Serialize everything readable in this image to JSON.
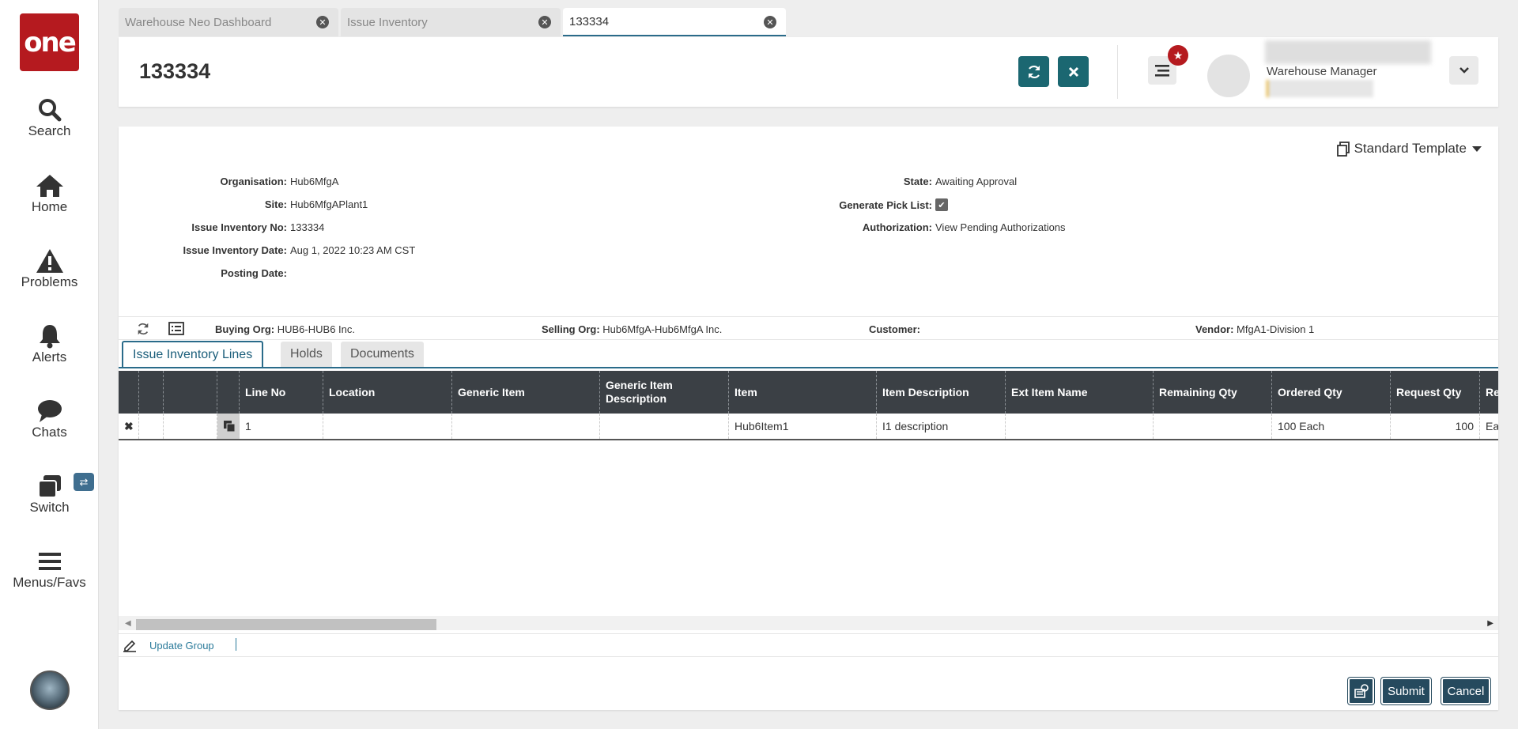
{
  "sidebar": {
    "logo": "one",
    "items": [
      {
        "label": "Search",
        "icon": "search-icon"
      },
      {
        "label": "Home",
        "icon": "home-icon"
      },
      {
        "label": "Problems",
        "icon": "warning-icon"
      },
      {
        "label": "Alerts",
        "icon": "bell-icon"
      },
      {
        "label": "Chats",
        "icon": "chat-icon"
      },
      {
        "label": "Switch",
        "icon": "switch-icon"
      },
      {
        "label": "Menus/Favs",
        "icon": "menu-icon"
      }
    ]
  },
  "tabs": [
    {
      "label": "Warehouse Neo Dashboard"
    },
    {
      "label": "Issue Inventory"
    },
    {
      "label": "133334"
    }
  ],
  "header": {
    "title": "133334",
    "user_role": "Warehouse Manager"
  },
  "template": {
    "label": "Standard Template"
  },
  "details": {
    "left": [
      {
        "label": "Organisation:",
        "value": "Hub6MfgA"
      },
      {
        "label": "Site:",
        "value": "Hub6MfgAPlant1"
      },
      {
        "label": "Issue Inventory No:",
        "value": "133334"
      },
      {
        "label": "Issue Inventory Date:",
        "value": "Aug 1, 2022 10:23 AM CST"
      },
      {
        "label": "Posting Date:",
        "value": ""
      }
    ],
    "right": [
      {
        "label": "State:",
        "value": "Awaiting Approval"
      },
      {
        "label": "Generate Pick List:",
        "value": "checked"
      },
      {
        "label": "Authorization:",
        "value": "View Pending Authorizations"
      }
    ]
  },
  "org_bar": {
    "buying_org_label": "Buying Org:",
    "buying_org": "HUB6-HUB6 Inc.",
    "selling_org_label": "Selling Org:",
    "selling_org": "Hub6MfgA-Hub6MfgA Inc.",
    "customer_label": "Customer:",
    "customer": "",
    "vendor_label": "Vendor:",
    "vendor": "MfgA1-Division 1"
  },
  "subtabs": [
    {
      "label": "Issue Inventory Lines"
    },
    {
      "label": "Holds"
    },
    {
      "label": "Documents"
    }
  ],
  "grid": {
    "columns": [
      "Line No",
      "Location",
      "Generic Item",
      "Generic Item Description",
      "Item",
      "Item Description",
      "Ext Item Name",
      "Remaining Qty",
      "Ordered Qty",
      "Request Qty",
      "Re UO"
    ],
    "rows": [
      {
        "line_no": "1",
        "location": "",
        "generic_item": "",
        "generic_item_desc": "",
        "item": "Hub6Item1",
        "item_desc": "I1 description",
        "ext_item": "",
        "remaining_qty": "",
        "ordered_qty": "100 Each",
        "request_qty": "100",
        "req_uom": "Ea"
      }
    ]
  },
  "footer": {
    "update_group": "Update Group"
  },
  "actions": {
    "submit": "Submit",
    "cancel": "Cancel"
  }
}
